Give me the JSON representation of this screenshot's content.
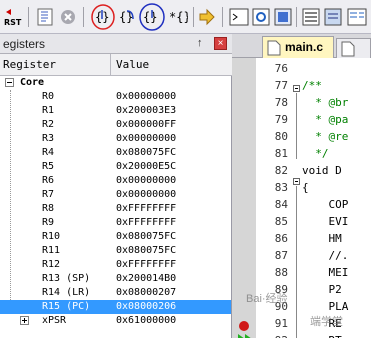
{
  "toolbar": {
    "reset_label": "RST",
    "buttons": [
      "reset-icon",
      "run-icon",
      "stop-icon",
      "step-into-icon",
      "step-over-icon",
      "step-out-icon",
      "run-to-cursor-icon",
      "show-next-statement-icon",
      "command-window-icon",
      "disassembly-window-icon",
      "symbols-window-icon",
      "registers-window-icon",
      "call-stack-icon"
    ],
    "annotation_colors": {
      "red": "#dd2020",
      "blue": "#2030c0"
    }
  },
  "registers_panel": {
    "title": "egisters",
    "pin": "↑",
    "close": "×",
    "columns": {
      "register": "Register",
      "value": "Value"
    },
    "group": "Core",
    "rows": [
      {
        "name": "R0",
        "value": "0x00000000"
      },
      {
        "name": "R1",
        "value": "0x200003E3"
      },
      {
        "name": "R2",
        "value": "0x000000FF"
      },
      {
        "name": "R3",
        "value": "0x00000000"
      },
      {
        "name": "R4",
        "value": "0x080075FC"
      },
      {
        "name": "R5",
        "value": "0x20000E5C"
      },
      {
        "name": "R6",
        "value": "0x00000000"
      },
      {
        "name": "R7",
        "value": "0x00000000"
      },
      {
        "name": "R8",
        "value": "0xFFFFFFFF"
      },
      {
        "name": "R9",
        "value": "0xFFFFFFFF"
      },
      {
        "name": "R10",
        "value": "0x080075FC"
      },
      {
        "name": "R11",
        "value": "0x080075FC"
      },
      {
        "name": "R12",
        "value": "0xFFFFFFFF"
      },
      {
        "name": "R13 (SP)",
        "value": "0x200014B0"
      },
      {
        "name": "R14 (LR)",
        "value": "0x08000207"
      },
      {
        "name": "R15 (PC)",
        "value": "0x08000206"
      },
      {
        "name": "xPSR",
        "value": "0x61000000"
      }
    ]
  },
  "editor": {
    "active_tab": "main.c",
    "lines": [
      {
        "num": "76",
        "text": ""
      },
      {
        "num": "77",
        "text": "/**"
      },
      {
        "num": "78",
        "text": "  * @br"
      },
      {
        "num": "79",
        "text": "  * @pa"
      },
      {
        "num": "80",
        "text": "  * @re"
      },
      {
        "num": "81",
        "text": "  */"
      },
      {
        "num": "82",
        "text": "void D"
      },
      {
        "num": "83",
        "text": "{"
      },
      {
        "num": "84",
        "text": "    COP"
      },
      {
        "num": "85",
        "text": "    EVI"
      },
      {
        "num": "86",
        "text": "    HM"
      },
      {
        "num": "87",
        "text": "    //."
      },
      {
        "num": "88",
        "text": "    MEI"
      },
      {
        "num": "89",
        "text": "    P2"
      },
      {
        "num": "90",
        "text": "    PLA"
      },
      {
        "num": "91",
        "text": "    RE"
      },
      {
        "num": "92",
        "text": "    RT"
      }
    ]
  },
  "watermark": {
    "line1": "Bai·经验",
    "line2": "端学堂"
  }
}
